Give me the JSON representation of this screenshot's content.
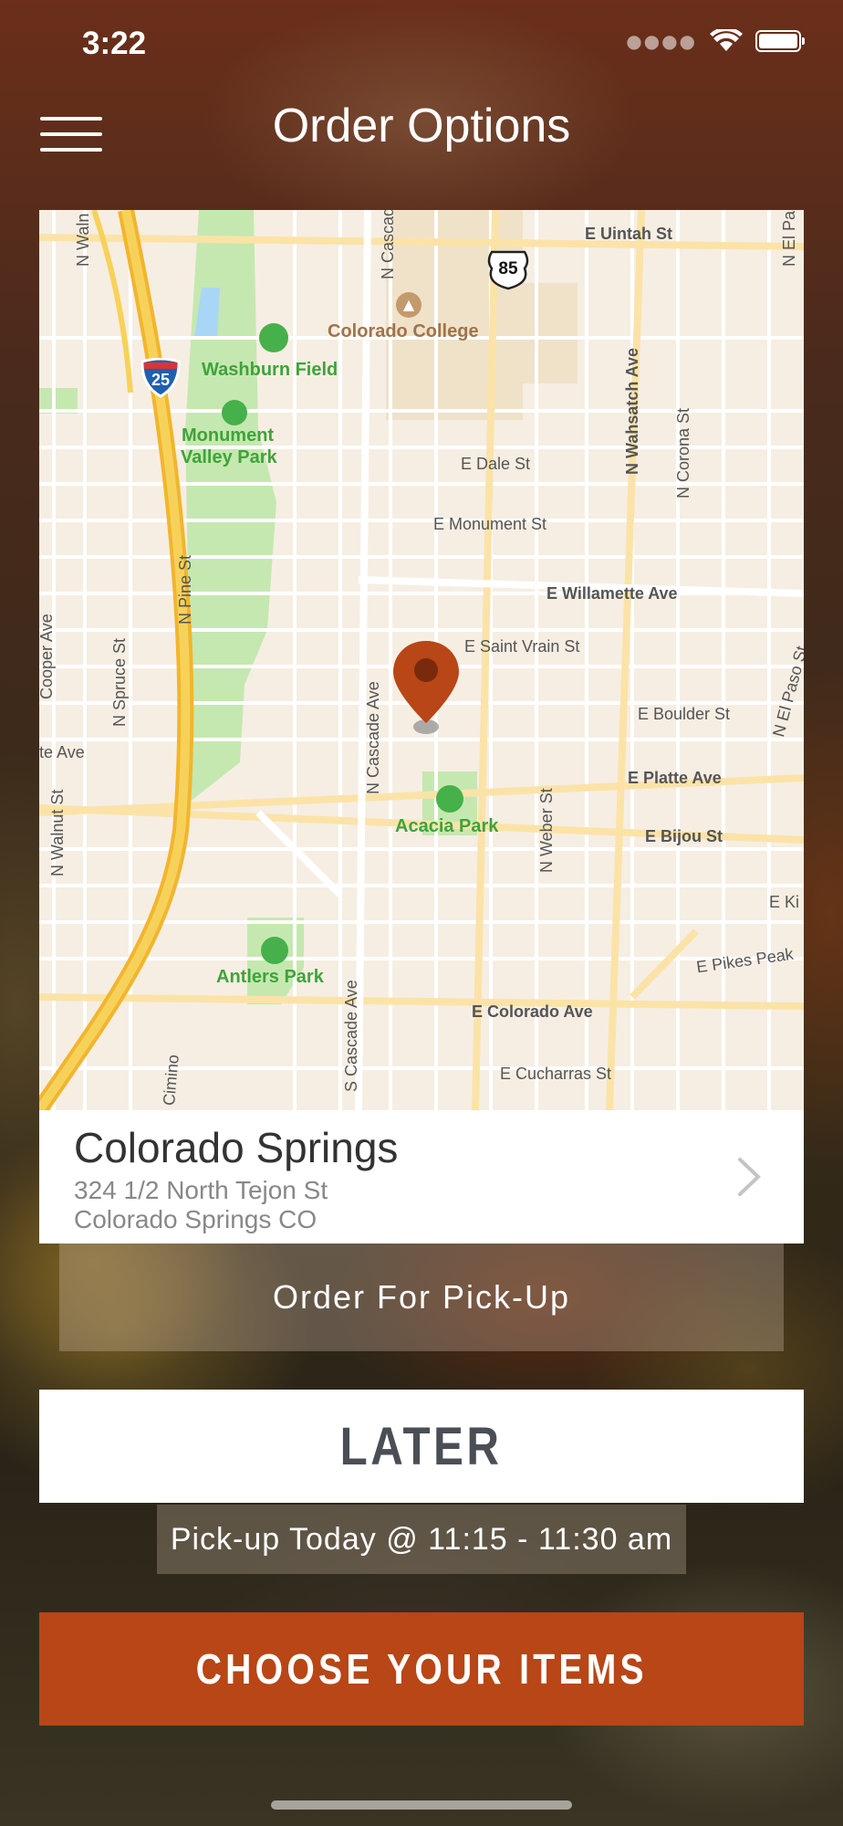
{
  "status_bar": {
    "time": "3:22",
    "signal_icon": "signal-dots-icon",
    "wifi_icon": "wifi-icon",
    "battery_icon": "battery-icon"
  },
  "header": {
    "title": "Order Options",
    "menu_icon": "hamburger-menu-icon"
  },
  "map": {
    "streets": [
      "E Uintah St",
      "E Dale St",
      "E Monument St",
      "E Willamette Ave",
      "E Saint Vrain St",
      "E Boulder St",
      "E Platte Ave",
      "E Bijou St",
      "E Pikes Peak",
      "E Colorado Ave",
      "E Cucharras St",
      "E Ki",
      "N Wahsatch Ave",
      "N Corona St",
      "N Cascade Ave",
      "N Pine St",
      "N Spruce St",
      "N Walnut St",
      "N Weber St",
      "N El Paso St",
      "N El Pas",
      "S Cascade Ave",
      "Cooper Ave",
      "te Ave",
      "N Waln",
      "N Cascad",
      "Cimino"
    ],
    "places": {
      "college": "Colorado College",
      "washburn": "Washburn Field",
      "monument_line1": "Monument",
      "monument_line2": "Valley Park",
      "acacia": "Acacia Park",
      "antlers": "Antlers Park"
    },
    "shields": {
      "interstate": "25",
      "us_route": "85"
    },
    "pin_icon": "location-pin-icon"
  },
  "location": {
    "name": "Colorado Springs",
    "address_line1": "324 1/2 North Tejon St",
    "address_line2": "Colorado Springs CO",
    "chevron_icon": "chevron-right-icon"
  },
  "order_type": {
    "label": "Order For Pick-Up"
  },
  "timing": {
    "label": "LATER",
    "pickup_time": "Pick-up Today @ 11:15 - 11:30 am"
  },
  "cta": {
    "label": "CHOOSE YOUR ITEMS"
  },
  "colors": {
    "accent": "#b84616",
    "map_bg": "#f6eee3",
    "park": "#c5e8b0",
    "highway": "#f7c844"
  }
}
